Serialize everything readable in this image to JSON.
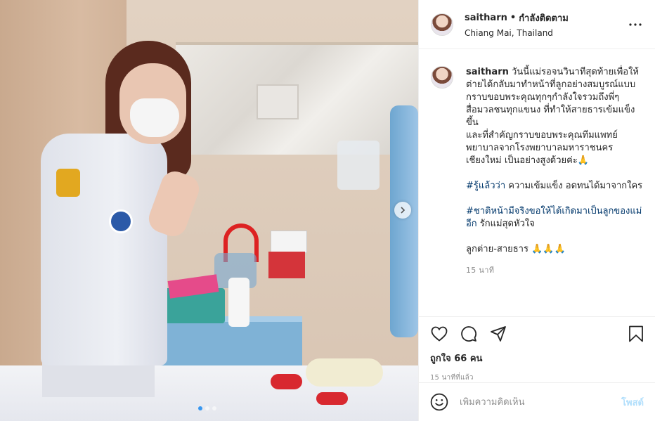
{
  "post": {
    "username": "saitharn",
    "separator": "•",
    "follow_status": "กำลังติดตาม",
    "location": "Chiang Mai, Thailand",
    "more_icon": "more-horizontal-icon"
  },
  "caption": {
    "username": "saitharn",
    "line1": "วันนี้แม่รอจนวินาทีสุดท้ายเพื่อให้ต่ายได้กลับมาทำหน้าที่ลูกอย่างสมบูรณ์แบบ",
    "line2": "กราบขอบพระคุณทุกๆกำลังใจรวมถึงพี่ๆสื่อมวลชนทุกแขนง ที่ทำให้สายธารเข้มแข็งขึ้น",
    "line3": "และที่สำคัญกราบขอบพระคุณทีมแพทย์พยาบาลจากโรงพยาบาลมหาราชนครเชียงใหม่ เป็นอย่างสูงด้วยค่ะ🙏",
    "tag1": "#รู้แล้วว่า",
    "tag1_text": " ความเข้มแข็ง อดทนได้มาจากใคร",
    "tag2": "#ชาติหน้ามีจริงขอให้ได้เกิดมาเป็นลูกของแม่อีก",
    "tag2_text": " รักแม่สุดหัวใจ",
    "signoff": "ลูกต่าย-สายธาร 🙏🙏🙏",
    "time": "15 นาที"
  },
  "actions": {
    "likes": "ถูกใจ 66 คน",
    "posted_ago": "15 นาทีที่แล้ว"
  },
  "comment_box": {
    "placeholder": "เพิ่มความคิดเห็น",
    "post_label": "โพสต์"
  },
  "carousel": {
    "slide_count": 3,
    "active_slide": 1
  },
  "colors": {
    "accent": "#3897f0",
    "hashtag": "#00376b",
    "muted": "#8e8e8e",
    "post_disabled": "#b2dffc"
  }
}
